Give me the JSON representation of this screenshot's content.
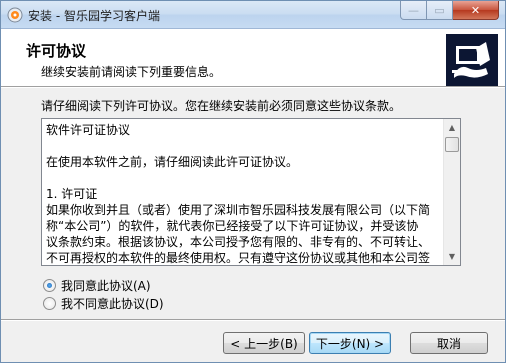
{
  "window": {
    "title": "安装 - 智乐园学习客户端",
    "icon": "installer-icon",
    "buttons": {
      "min": "—",
      "max": "▭",
      "close": "✕"
    }
  },
  "header": {
    "title": "许可协议",
    "subtitle": "继续安装前请阅读下列重要信息。",
    "logo": "computer-install-icon"
  },
  "main": {
    "prompt": "请仔细阅读下列许可协议。您在继续安装前必须同意这些协议条款。",
    "license_lines": [
      "软件许可证协议",
      "",
      "在使用本软件之前，请仔细阅读此许可证协议。",
      "",
      "1. 许可证",
      "如果你收到并且（或者）使用了深圳市智乐园科技发展有限公司（以下简",
      "称“本公司”）的软件，就代表你已经接受了以下许可证协议，并受该协",
      "议条款约束。根据该协议，本公司授予您有限的、非专有的、不可转让、",
      "不可再授权的本软件的最终使用权。只有遵守这份协议或其他和本公司签"
    ],
    "accept_label": "我同意此协议(A)",
    "decline_label": "我不同意此协议(D)",
    "accept_selected": true
  },
  "footer": {
    "back_label": "< 上一步(B)",
    "next_label": "下一步(N) >",
    "cancel_label": "取消"
  }
}
